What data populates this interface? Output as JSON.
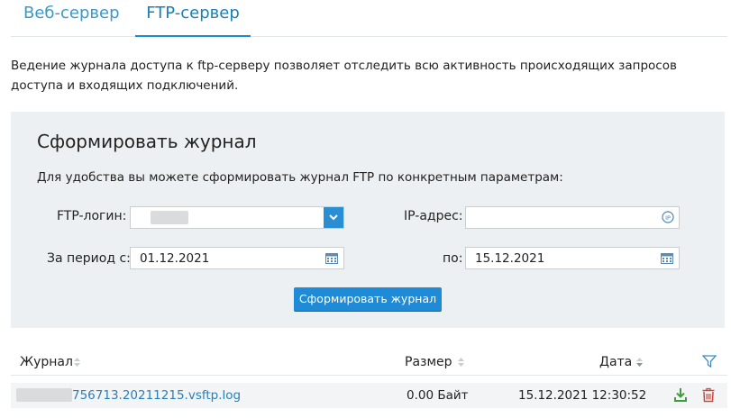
{
  "tabs": {
    "web": "Веб-сервер",
    "ftp": "FTP-сервер"
  },
  "description": "Ведение журнала доступа к ftp-серверу позволяет отследить всю активность происходящих запросов доступа и входящих подключений.",
  "panel": {
    "title": "Сформировать журнал",
    "subtitle": "Для удобства вы можете сформировать журнал FTP по конкретным параметрам:",
    "login_label": "FTP-логин:",
    "login_value": "",
    "ip_label": "IP-адрес:",
    "ip_value": "",
    "period_from_label": "За период с:",
    "period_from_value": "01.12.2021",
    "period_to_label": "по:",
    "period_to_value": "15.12.2021",
    "submit_label": "Сформировать журнал"
  },
  "table": {
    "columns": {
      "journal": "Журнал",
      "size": "Размер",
      "date": "Дата"
    },
    "rows": [
      {
        "name": "756713.20211215.vsftp.log",
        "size": "0.00 Байт",
        "date": "15.12.2021 12:30:52"
      }
    ]
  },
  "colors": {
    "accent": "#1f8ad6",
    "tab_active": "#1a7fb6",
    "panel_bg": "#edf0f2",
    "download": "#3f9e3a",
    "delete": "#d0463a"
  },
  "icons": {
    "select": "chevron-down-icon",
    "ip": "ip-icon",
    "calendar": "calendar-icon",
    "filter": "filter-icon",
    "download": "download-icon",
    "delete": "trash-icon"
  }
}
